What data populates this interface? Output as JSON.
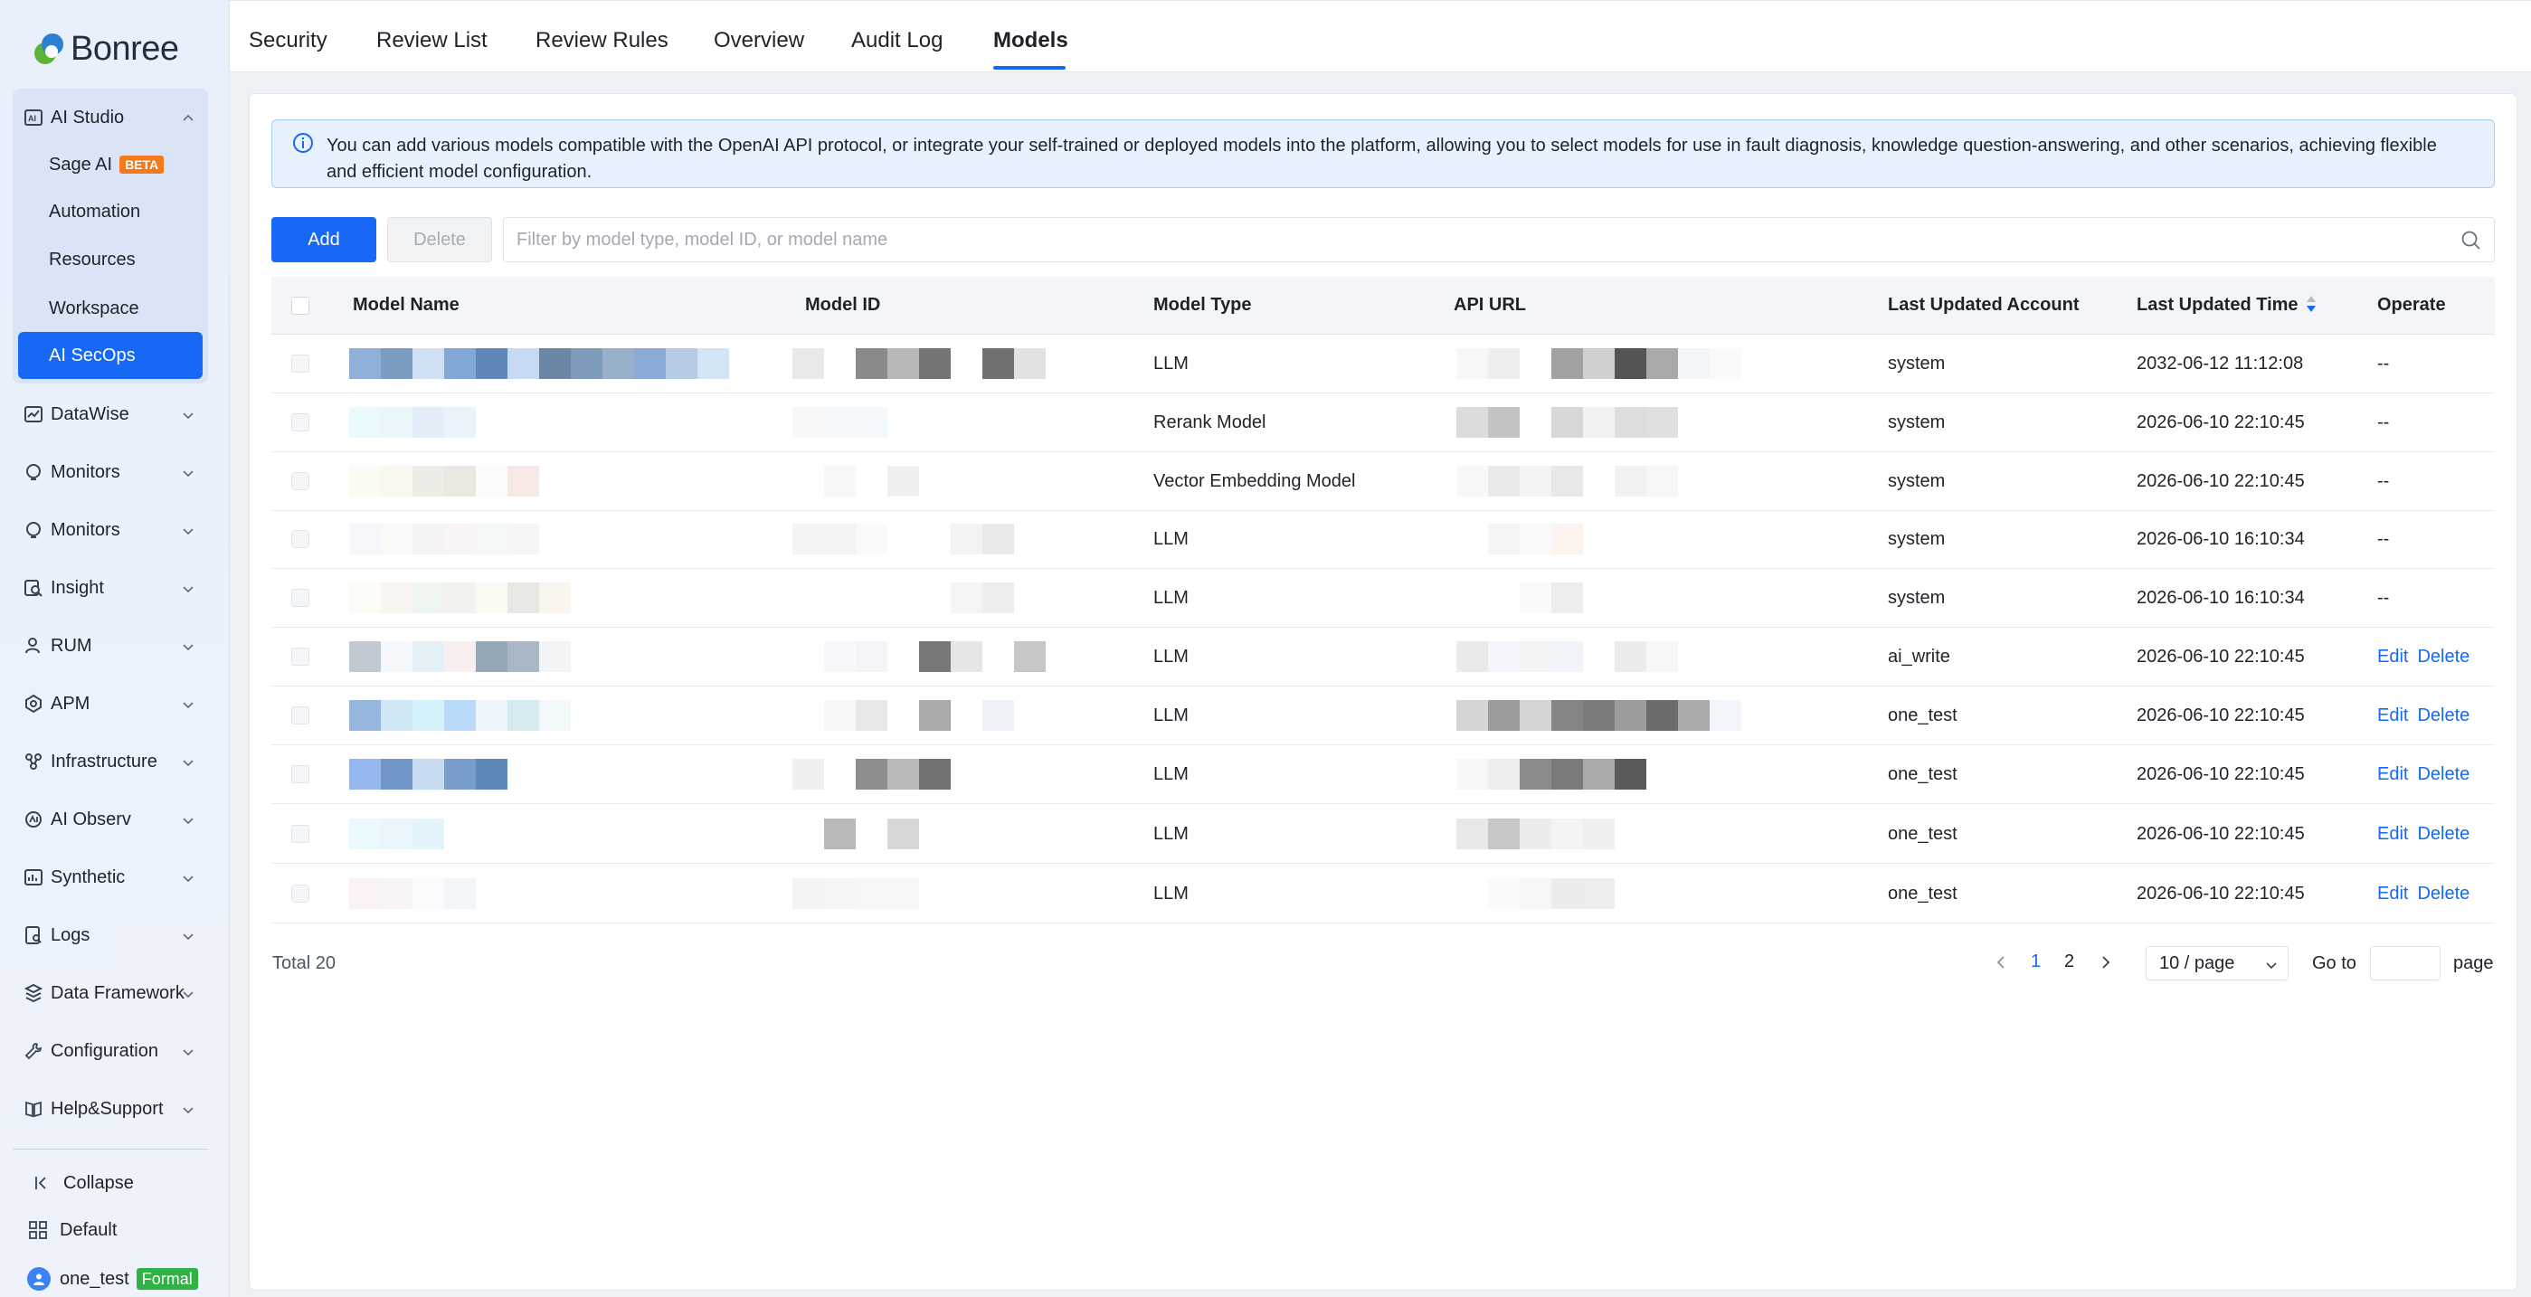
{
  "app": {
    "brand": "Bonree",
    "accent_color": "#1668f5"
  },
  "sidebar": {
    "open_group": {
      "label": "AI Studio",
      "icon": "ai-studio-icon",
      "items": [
        {
          "label": "Sage AI",
          "badge": "BETA"
        },
        {
          "label": "Automation"
        },
        {
          "label": "Resources"
        },
        {
          "label": "Workspace"
        },
        {
          "label": "AI SecOps",
          "active": true
        }
      ]
    },
    "groups": [
      {
        "label": "DataWise",
        "icon": "chart-icon"
      },
      {
        "label": "Monitors",
        "icon": "monitor-icon"
      },
      {
        "label": "Monitors",
        "icon": "monitor-icon"
      },
      {
        "label": "Insight",
        "icon": "insight-icon"
      },
      {
        "label": "RUM",
        "icon": "user-icon"
      },
      {
        "label": "APM",
        "icon": "apm-icon"
      },
      {
        "label": "Infrastructure",
        "icon": "infrastructure-icon"
      },
      {
        "label": "AI Observ",
        "icon": "ai-observ-icon"
      },
      {
        "label": "Synthetic",
        "icon": "synthetic-icon"
      },
      {
        "label": "Logs",
        "icon": "logs-icon"
      },
      {
        "label": "Data Framework",
        "icon": "data-framework-icon"
      },
      {
        "label": "Configuration",
        "icon": "wrench-icon"
      },
      {
        "label": "Help&Support",
        "icon": "book-icon"
      }
    ],
    "footer": {
      "collapse": "Collapse",
      "workspace": "Default",
      "user": "one_test",
      "user_badge": "Formal"
    }
  },
  "tabs": [
    {
      "label": "Security"
    },
    {
      "label": "Review List"
    },
    {
      "label": "Review Rules"
    },
    {
      "label": "Overview"
    },
    {
      "label": "Audit Log"
    },
    {
      "label": "Models",
      "active": true
    }
  ],
  "notice": {
    "text": "You can add various models compatible with the OpenAI API protocol, or integrate your self-trained or deployed models into the platform, allowing you to select models for use in fault diagnosis, knowledge question-answering, and other scenarios, achieving flexible and efficient model configuration."
  },
  "toolbar": {
    "add_label": "Add",
    "delete_label": "Delete",
    "search_placeholder": "Filter by model type, model ID, or model name"
  },
  "table": {
    "columns": [
      "Model Name",
      "Model ID",
      "Model Type",
      "API URL",
      "Last Updated Account",
      "Last Updated Time",
      "Operate"
    ],
    "rows": [
      {
        "type": "LLM",
        "account": "system",
        "time": "2032-06-12 11:12:08",
        "operate": "--"
      },
      {
        "type": "Rerank Model",
        "account": "system",
        "time": "2026-06-10 22:10:45",
        "operate": "--"
      },
      {
        "type": "Vector Embedding Model",
        "account": "system",
        "time": "2026-06-10 22:10:45",
        "operate": "--"
      },
      {
        "type": "LLM",
        "account": "system",
        "time": "2026-06-10 16:10:34",
        "operate": "--"
      },
      {
        "type": "LLM",
        "account": "system",
        "time": "2026-06-10 16:10:34",
        "operate": "--"
      },
      {
        "type": "LLM",
        "account": "ai_write",
        "time": "2026-06-10 22:10:45",
        "edit": "Edit",
        "delete": "Delete"
      },
      {
        "type": "LLM",
        "account": "one_test",
        "time": "2026-06-10 22:10:45",
        "edit": "Edit",
        "delete": "Delete"
      },
      {
        "type": "LLM",
        "account": "one_test",
        "time": "2026-06-10 22:10:45",
        "edit": "Edit",
        "delete": "Delete"
      },
      {
        "type": "LLM",
        "account": "one_test",
        "time": "2026-06-10 22:10:45",
        "edit": "Edit",
        "delete": "Delete"
      },
      {
        "type": "LLM",
        "account": "one_test",
        "time": "2026-06-10 22:10:45",
        "edit": "Edit",
        "delete": "Delete"
      }
    ]
  },
  "pagination": {
    "total": "Total 20",
    "pages": [
      "1",
      "2"
    ],
    "current_page": "1",
    "page_size": "10 / page",
    "goto_label": "Go to",
    "page_label": "page"
  }
}
